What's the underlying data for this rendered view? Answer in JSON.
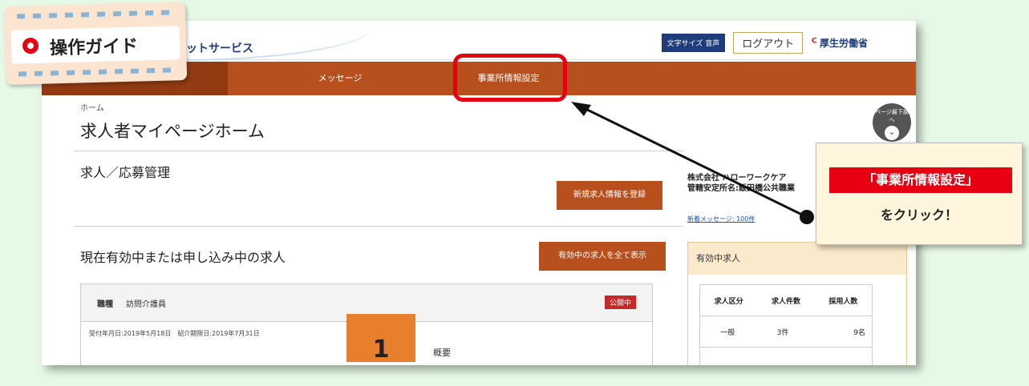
{
  "guide": {
    "label": "操作ガイド"
  },
  "header": {
    "service_name_fragment": "ットサービス",
    "accessibility_button": "文字サイズ 音声",
    "logout_button": "ログアウト",
    "ministry_logo": "厚生労働省"
  },
  "nav": {
    "items": [
      {
        "label": ""
      },
      {
        "label": "メッセージ"
      },
      {
        "label": "事業所情報設定"
      }
    ]
  },
  "breadcrumb": "ホーム",
  "page_title": "求人者マイページホーム",
  "scroll_button": {
    "label": "ページ最下部へ"
  },
  "sections": {
    "recruit": {
      "title": "求人／応募管理",
      "new_button": "新規求人情報を登録"
    },
    "active": {
      "title": "現在有効中または申し込み中の求人",
      "show_all_button": "有効中の求人を全て表示"
    }
  },
  "job": {
    "label": "職種",
    "value": "訪問介護員",
    "status": "公開中",
    "dates": "受付年月日:2019年5月18日　紹介期限日:2019年7月31日"
  },
  "sidebar": {
    "company_line1": "株式会社 ハローワークケア",
    "company_line2": "管轄安定所名:飯田橋公共職業",
    "new_messages": "新着メッセージ: 100件",
    "active_title": "有効中求人",
    "table": {
      "headers": [
        "求人区分",
        "求人件数",
        "採用人数"
      ],
      "rows": [
        [
          "一般",
          "3件",
          "9名"
        ]
      ]
    }
  },
  "callout": {
    "highlight": "「事業所情報設定」",
    "instruction": "をクリック！"
  },
  "step": {
    "number": "1",
    "caption_fragment": "概要"
  },
  "colors": {
    "nav_bar": "#b8501e",
    "highlight_red": "#e60012",
    "background": "#e6f9e6",
    "step_badge": "#e87f2c"
  }
}
